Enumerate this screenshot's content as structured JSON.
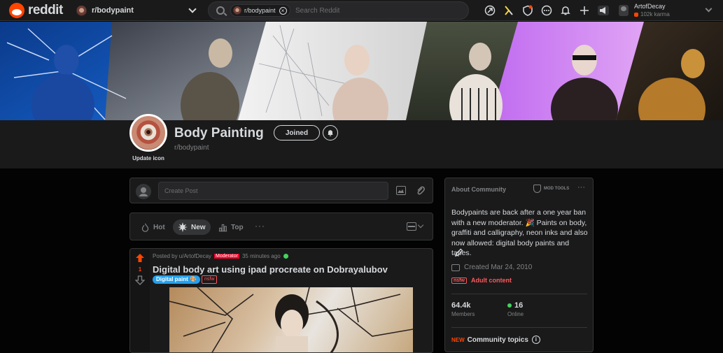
{
  "topbar": {
    "logo_text": "reddit",
    "community_dropdown": "r/bodypaint",
    "search": {
      "chip": "r/bodypaint",
      "placeholder": "Search Reddit"
    },
    "icons": [
      "popular-icon",
      "coins-icon",
      "shield-icon",
      "chat-icon",
      "bell-icon",
      "plus-icon",
      "megaphone-icon"
    ],
    "user": {
      "name": "ArtofDecay",
      "karma": "102k karma"
    }
  },
  "community": {
    "title": "Body Painting",
    "subreddit": "r/bodypaint",
    "update_icon": "Update icon",
    "joined_label": "Joined"
  },
  "create_post": {
    "placeholder": "Create Post"
  },
  "sort": {
    "hot": "Hot",
    "new": "New",
    "top": "Top",
    "more": "···"
  },
  "post": {
    "votes": "1",
    "posted_by": "Posted by u/ArtofDecay",
    "mod_badge": "Moderator",
    "time": "35 minutes ago",
    "title": "Digital body art using ipad procreate on Dobrayalubov",
    "flair": "Digital paint 🎨",
    "nsfw": "nsfw"
  },
  "sidebar": {
    "heading": "About Community",
    "mod_tools": "MOD TOOLS",
    "description": "Bodypaints are back after a one year ban with a new moderator. 🎉 Paints on body, graffiti and calligraphy, neon inks and also now allowed: digital body paints and tapes.",
    "created": "Created Mar 24, 2010",
    "nsfw_tag": "nsfw",
    "adult": "Adult content",
    "members_count": "64.4k",
    "members_label": "Members",
    "online_count": "16",
    "online_label": "Online",
    "new_tag": "NEW",
    "topics": "Community topics"
  },
  "colors": {
    "accent": "#ff4500",
    "bg": "#030303",
    "card": "#1a1a1b",
    "border": "#343536",
    "text": "#d7dadc",
    "muted": "#818384"
  }
}
